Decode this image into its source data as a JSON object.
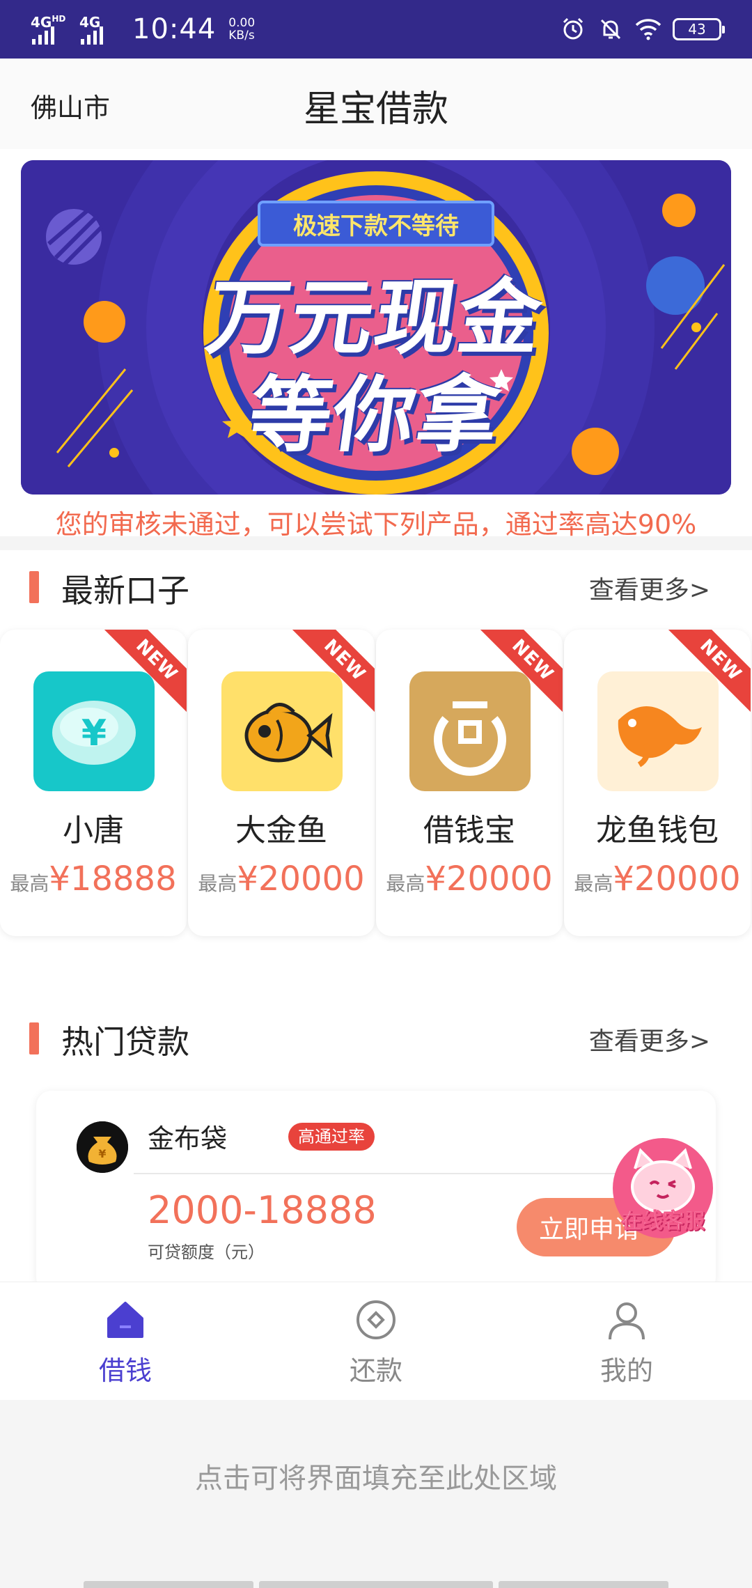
{
  "status_bar": {
    "network1": "4G",
    "network1_sup": "HD",
    "network2": "4G",
    "time": "10:44",
    "speed_value": "0.00",
    "speed_unit": "KB/s",
    "battery": "43",
    "icons": [
      "alarm-icon",
      "bell-off-icon",
      "wifi-icon",
      "battery-icon"
    ]
  },
  "header": {
    "city": "佛山市",
    "title": "星宝借款"
  },
  "banner": {
    "tag": "极速下款不等待",
    "line1": "万元现金",
    "line2": "等你拿"
  },
  "notice": "您的审核未通过，可以尝试下列产品，通过率高达90%",
  "sections": {
    "latest": {
      "title": "最新口子",
      "more": "查看更多>"
    },
    "hot": {
      "title": "热门贷款",
      "more": "查看更多>"
    }
  },
  "products": [
    {
      "name": "小唐",
      "prefix": "最高",
      "amount": "¥18888",
      "badge": "NEW"
    },
    {
      "name": "大金鱼",
      "prefix": "最高",
      "amount": "¥20000",
      "badge": "NEW"
    },
    {
      "name": "借钱宝",
      "prefix": "最高",
      "amount": "¥20000",
      "badge": "NEW"
    },
    {
      "name": "龙鱼钱包",
      "prefix": "最高",
      "amount": "¥20000",
      "badge": "NEW"
    }
  ],
  "hot_loan": {
    "name": "金布袋",
    "badge": "高通过率",
    "range": "2000-18888",
    "range_caption": "可贷额度（元）",
    "apply_label": "立即申请",
    "logo_caption": "金布袋"
  },
  "float_service": {
    "label": "在线客服"
  },
  "tabbar": {
    "items": [
      {
        "label": "借钱",
        "icon": "home-icon",
        "active": true
      },
      {
        "label": "还款",
        "icon": "repay-icon",
        "active": false
      },
      {
        "label": "我的",
        "icon": "user-icon",
        "active": false
      }
    ],
    "active_color": "#4b3fd0",
    "inactive_color": "#888888"
  },
  "fill_hint": "点击可将界面填充至此处区域",
  "colors": {
    "status_bar": "#33298a",
    "accent": "#f2715a",
    "badge_red": "#e8433c"
  }
}
